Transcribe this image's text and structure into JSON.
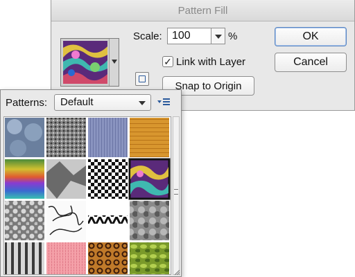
{
  "dialog": {
    "title": "Pattern Fill",
    "scale_label": "Scale:",
    "scale_value": "100",
    "scale_unit": "%",
    "link_with_layer_label": "Link with Layer",
    "link_with_layer_checked": true,
    "snap_to_origin_label": "Snap to Origin",
    "ok_label": "OK",
    "cancel_label": "Cancel"
  },
  "picker": {
    "patterns_label": "Patterns:",
    "preset_value": "Default",
    "menu_icon": "flyout-menu-icon",
    "tiles": [
      {
        "name": "pattern-bubbles"
      },
      {
        "name": "pattern-gravel"
      },
      {
        "name": "pattern-blue-fabric"
      },
      {
        "name": "pattern-wood"
      },
      {
        "name": "pattern-rainbow"
      },
      {
        "name": "pattern-crumpled-paper"
      },
      {
        "name": "pattern-checkerboard"
      },
      {
        "name": "pattern-tie-dye",
        "selected": true
      },
      {
        "name": "pattern-gray-spots"
      },
      {
        "name": "pattern-scribble"
      },
      {
        "name": "pattern-herringbone"
      },
      {
        "name": "pattern-gray-clouds"
      },
      {
        "name": "pattern-zebra"
      },
      {
        "name": "pattern-pink-fur"
      },
      {
        "name": "pattern-leopard"
      },
      {
        "name": "pattern-leaves"
      }
    ]
  }
}
